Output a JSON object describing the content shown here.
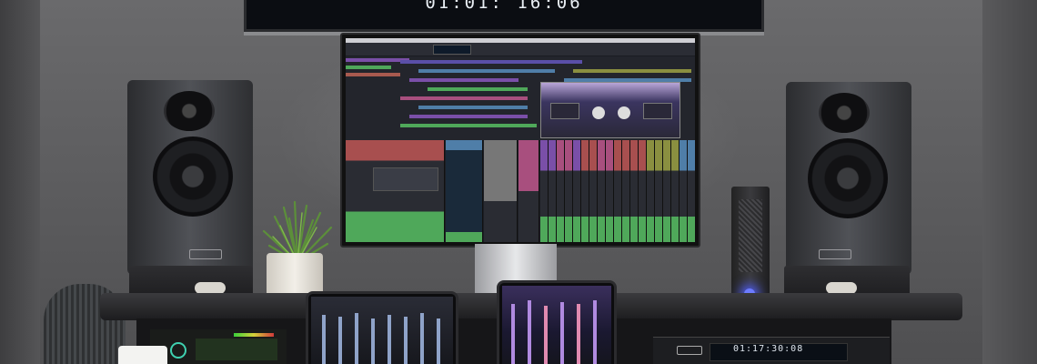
{
  "wall_timecode": "01:01: 16:06",
  "interface_timecode": "01:17:30:08",
  "colors": {
    "wall": "#5e5e60",
    "tv_screen": "#0b0d12",
    "led_blue": "#6d7cff",
    "daw_purple": "#7a4fa8",
    "daw_green": "#4fa85a",
    "daw_blue": "#4f7ea8"
  },
  "icons": [
    "speaker-icon",
    "plant-icon",
    "monitor-icon",
    "tablet-icon",
    "tower-icon"
  ]
}
